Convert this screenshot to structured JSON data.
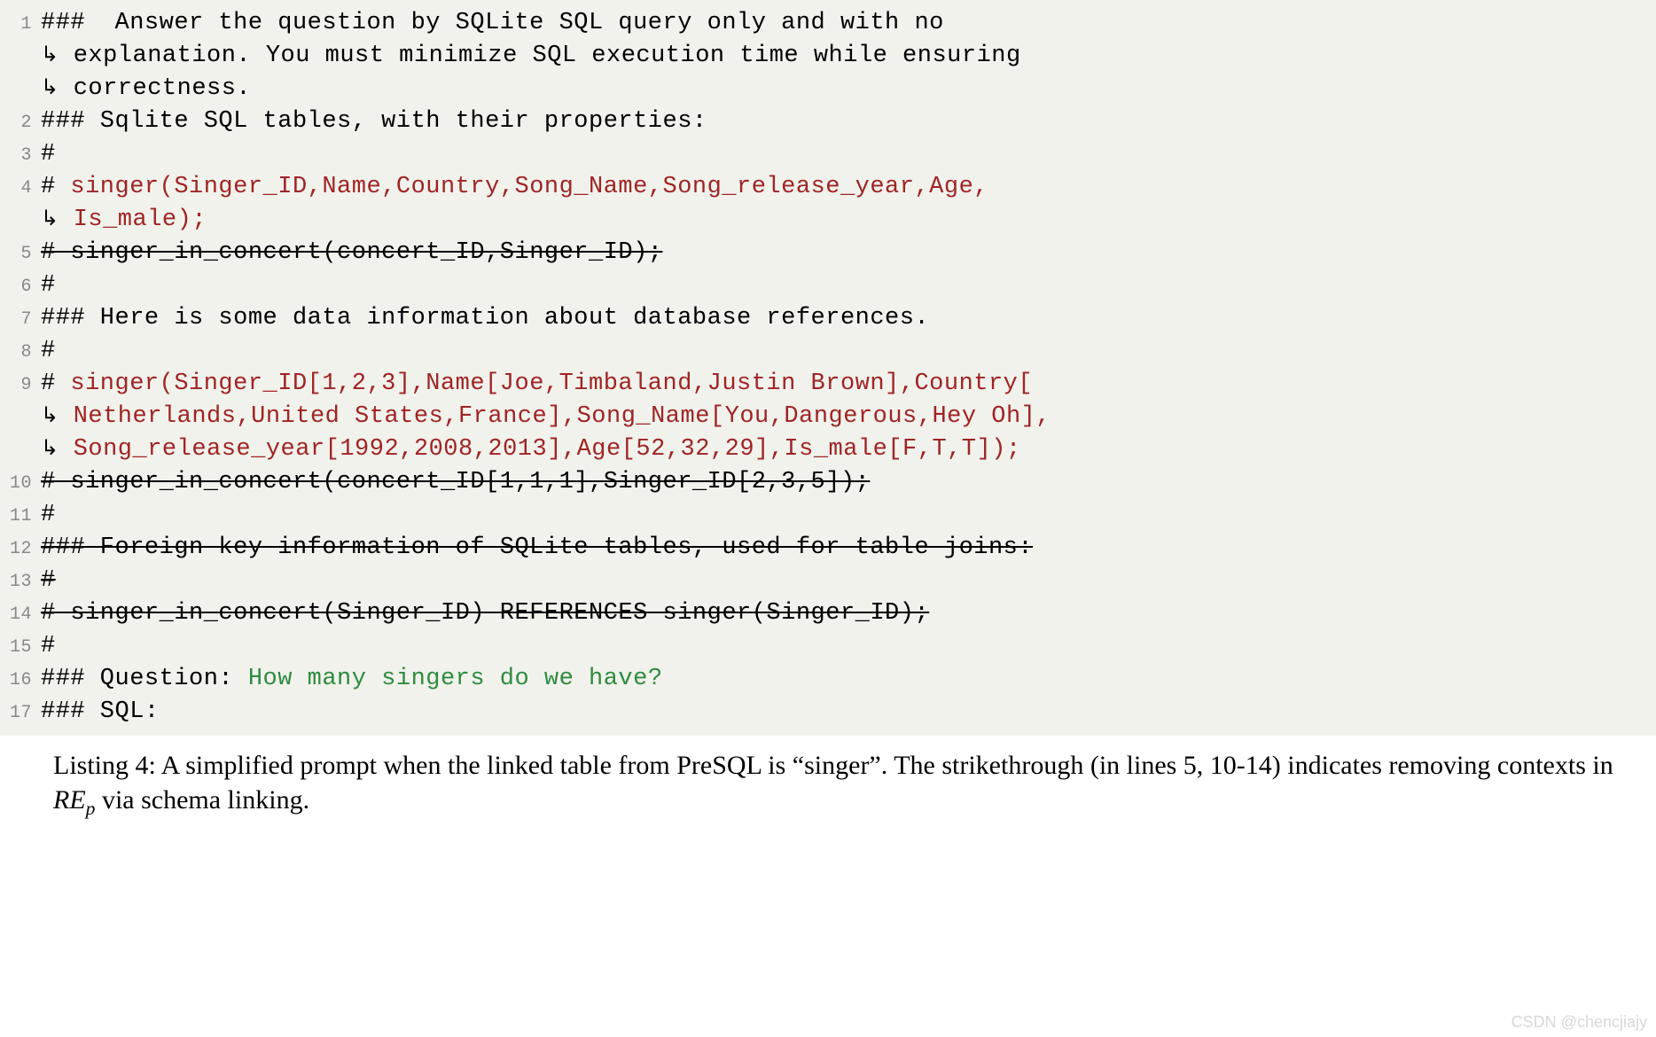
{
  "code": {
    "l1a": "###  Answer the question by SQLite SQL query only and with no",
    "l1b": "explanation. You must minimize SQL execution time while ensuring",
    "l1c": "correctness.",
    "l2": "### Sqlite SQL tables, with their properties:",
    "l3": "#",
    "l4a": "singer(Singer_ID,Name,Country,Song_Name,Song_release_year,Age,",
    "l4b": "Is_male);",
    "l5": "singer_in_concert(concert_ID,Singer_ID);",
    "l6": "#",
    "l7": "### Here is some data information about database references.",
    "l8": "#",
    "l9a": "singer(Singer_ID[1,2,3],Name[Joe,Timbaland,Justin Brown],Country[",
    "l9b": "Netherlands,United States,France],Song_Name[You,Dangerous,Hey Oh],",
    "l9c": "Song_release_year[1992,2008,2013],Age[52,32,29],Is_male[F,T,T]);",
    "l10": "singer_in_concert(concert_ID[1,1,1],Singer_ID[2,3,5]);",
    "l11": "#",
    "l12": "### Foreign key information of SQLite tables, used for table joins:",
    "l13": "#",
    "l14": "singer_in_concert(Singer_ID) REFERENCES singer(Singer_ID);",
    "l15": "#",
    "l16h": "### Question: ",
    "l16q": "How many singers do we have?",
    "l17": "### SQL:"
  },
  "caption": {
    "prefix": "Listing 4: A simplified prompt when the linked table from PreSQL is “singer”. The strikethrough (in lines 5, 10-14) indicates removing contexts in ",
    "var": "RE",
    "sub": "p",
    "suffix": " via schema linking."
  },
  "watermark": "CSDN @chencjiajy"
}
